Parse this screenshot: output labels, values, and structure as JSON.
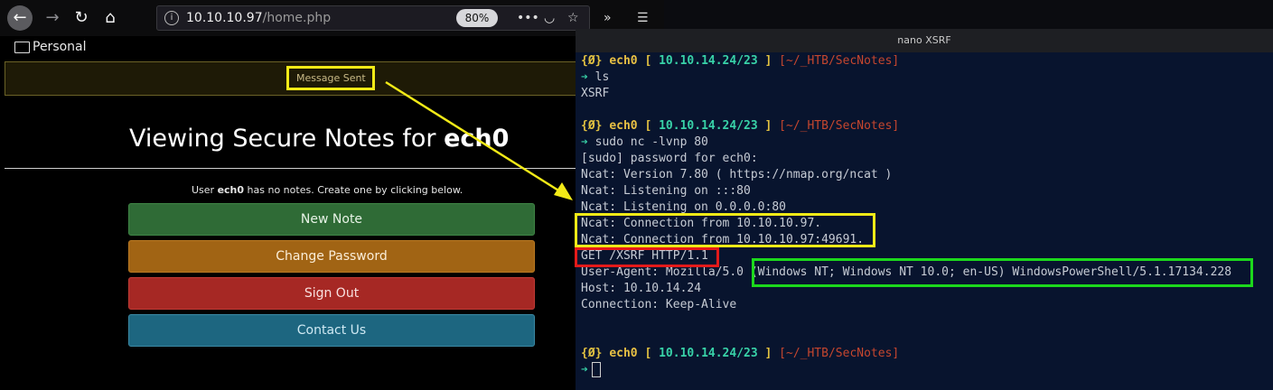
{
  "browser": {
    "url_host": "10.10.10.97",
    "url_path": "/home.php",
    "zoom": "80%",
    "bookmark_folder": "Personal",
    "alert": "Message Sent",
    "title_prefix": "Viewing Secure Notes for",
    "title_user": "ech0",
    "no_notes_prefix": "User",
    "no_notes_user": "ech0",
    "no_notes_suffix": "has no notes. Create one by clicking below.",
    "buttons": {
      "new_note": "New Note",
      "change_password": "Change Password",
      "sign_out": "Sign Out",
      "contact_us": "Contact Us"
    }
  },
  "terminal": {
    "title": "nano XSRF",
    "prompt": {
      "open": "{Ø}",
      "user": "ech0",
      "ip_open": "[",
      "ip": "10.10.14.24/23",
      "ip_close": "]",
      "path": "[~/_HTB/SecNotes]",
      "arrow": "➔"
    },
    "lines": {
      "cmd1": "ls",
      "out1": "XSRF",
      "cmd2": "sudo nc -lvnp 80",
      "sudo": "[sudo] password for ech0:",
      "version": "Ncat: Version 7.80 ( https://nmap.org/ncat )",
      "listen6": "Ncat: Listening on :::80",
      "listen4": "Ncat: Listening on 0.0.0.0:80",
      "conn1": "Ncat: Connection from 10.10.10.97.",
      "conn2": "Ncat: Connection from 10.10.10.97:49691.",
      "get": "GET /XSRF HTTP/1.1",
      "ua": "User-Agent: Mozilla/5.0 (Windows NT; Windows NT 10.0; en-US) WindowsPowerShell/5.1.17134.228",
      "host": "Host: 10.10.14.24",
      "connection": "Connection: Keep-Alive"
    }
  },
  "colors": {
    "highlight_yellow": "#f2ea17",
    "highlight_red": "#e41a1a",
    "highlight_green": "#1cd81c"
  }
}
